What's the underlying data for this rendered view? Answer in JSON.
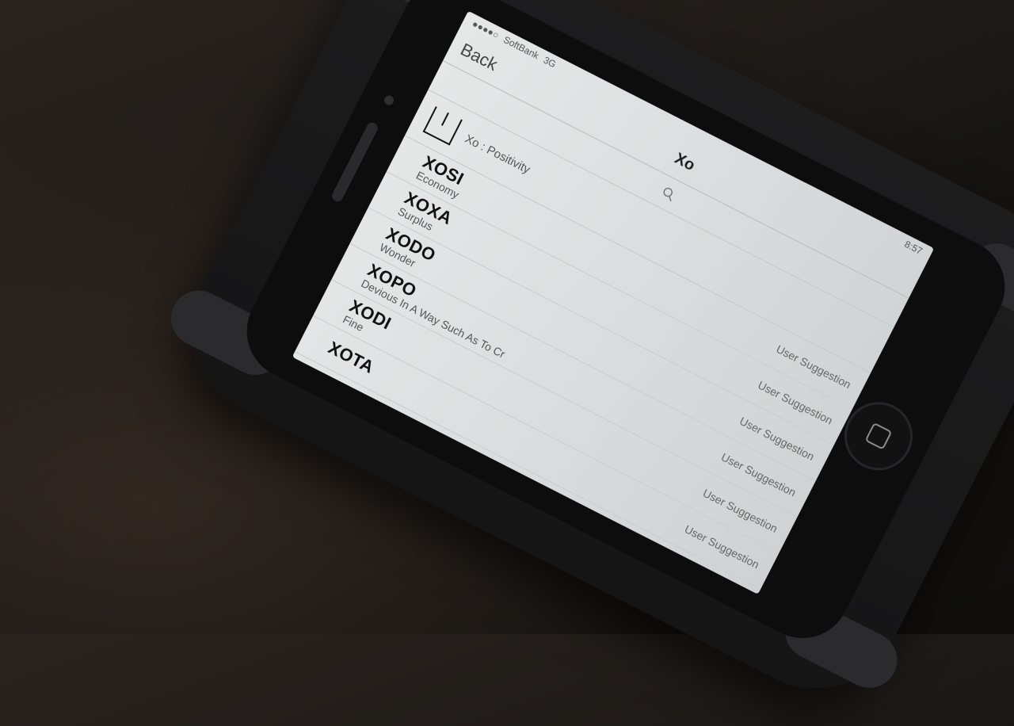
{
  "status_bar": {
    "carrier": "SoftBank",
    "network": "3G",
    "time": "8:57"
  },
  "nav": {
    "back_label": "Back",
    "title": "Xo",
    "search_icon": "search-icon"
  },
  "header": {
    "subtitle": "Xo : Positivity"
  },
  "entries": [
    {
      "word": "XOSI",
      "meaning": "Economy",
      "tag": "User Suggestion"
    },
    {
      "word": "XOXA",
      "meaning": "Surplus",
      "tag": "User Suggestion"
    },
    {
      "word": "XODO",
      "meaning": "Wonder",
      "tag": "User Suggestion"
    },
    {
      "word": "XOPO",
      "meaning": "Devious In A Way Such As To Cr",
      "tag": "User Suggestion"
    },
    {
      "word": "XODI",
      "meaning": "Fine",
      "tag": "User Suggestion"
    },
    {
      "word": "XOTA",
      "meaning": "",
      "tag": "User Suggestion"
    }
  ]
}
